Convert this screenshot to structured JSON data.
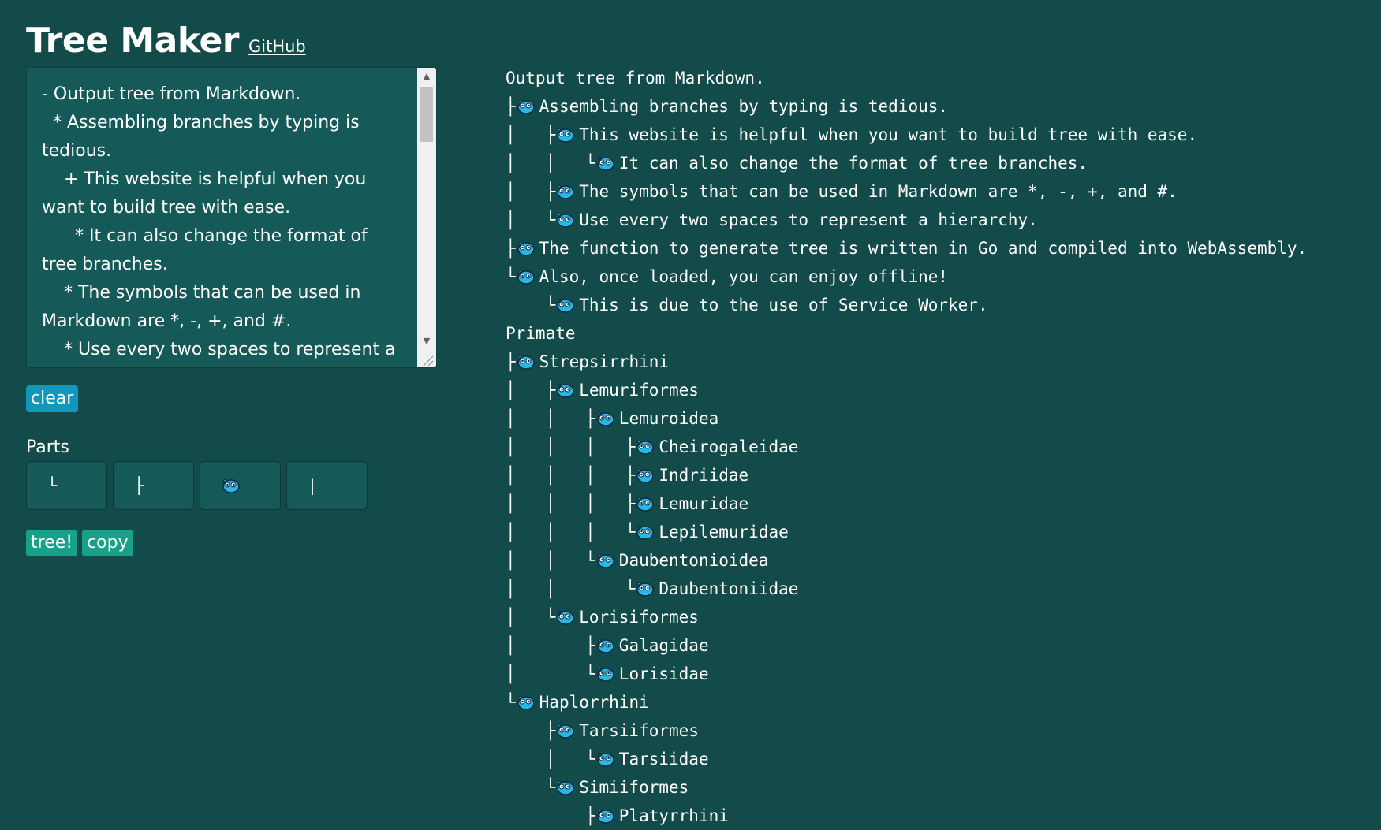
{
  "header": {
    "title": "Tree Maker",
    "github_label": "GitHub"
  },
  "editor": {
    "value": "- Output tree from Markdown.\n  * Assembling branches by typing is tedious.\n    + This website is helpful when you want to build tree with ease.\n      * It can also change the format of tree branches.\n    * The symbols that can be used in Markdown are *, -, +, and #.\n    * Use every two spaces to represent a"
  },
  "buttons": {
    "clear": "clear",
    "tree": "tree!",
    "copy": "copy"
  },
  "parts": {
    "label": "Parts",
    "items": [
      {
        "symbol": "└",
        "icon": ""
      },
      {
        "symbol": "├",
        "icon": ""
      },
      {
        "symbol": "",
        "icon": "go-gopher-icon"
      },
      {
        "symbol": "|",
        "icon": ""
      }
    ]
  },
  "colors": {
    "background": "#134a4a",
    "editor_bg": "#155a58",
    "clear_button": "#1197b9",
    "action_button": "#17a08a",
    "icon_blue": "#29b8e6"
  },
  "output": {
    "lines": [
      {
        "prefix": "",
        "icon": false,
        "text": "Output tree from Markdown."
      },
      {
        "prefix": "├",
        "icon": true,
        "text": "Assembling branches by typing is tedious."
      },
      {
        "prefix": "│   ├",
        "icon": true,
        "text": "This website is helpful when you want to build tree with ease."
      },
      {
        "prefix": "│   │   └",
        "icon": true,
        "text": "It can also change the format of tree branches."
      },
      {
        "prefix": "│   ├",
        "icon": true,
        "text": "The symbols that can be used in Markdown are *, -, +, and #."
      },
      {
        "prefix": "│   └",
        "icon": true,
        "text": "Use every two spaces to represent a hierarchy."
      },
      {
        "prefix": "├",
        "icon": true,
        "text": "The function to generate tree is written in Go and compiled into WebAssembly."
      },
      {
        "prefix": "└",
        "icon": true,
        "text": "Also, once loaded, you can enjoy offline!"
      },
      {
        "prefix": "    └",
        "icon": true,
        "text": "This is due to the use of Service Worker."
      },
      {
        "prefix": "",
        "icon": false,
        "text": "Primate"
      },
      {
        "prefix": "├",
        "icon": true,
        "text": "Strepsirrhini"
      },
      {
        "prefix": "│   ├",
        "icon": true,
        "text": "Lemuriformes"
      },
      {
        "prefix": "│   │   ├",
        "icon": true,
        "text": "Lemuroidea"
      },
      {
        "prefix": "│   │   │   ├",
        "icon": true,
        "text": "Cheirogaleidae"
      },
      {
        "prefix": "│   │   │   ├",
        "icon": true,
        "text": "Indriidae"
      },
      {
        "prefix": "│   │   │   ├",
        "icon": true,
        "text": "Lemuridae"
      },
      {
        "prefix": "│   │   │   └",
        "icon": true,
        "text": "Lepilemuridae"
      },
      {
        "prefix": "│   │   └",
        "icon": true,
        "text": "Daubentonioidea"
      },
      {
        "prefix": "│   │       └",
        "icon": true,
        "text": "Daubentoniidae"
      },
      {
        "prefix": "│   └",
        "icon": true,
        "text": "Lorisiformes"
      },
      {
        "prefix": "│       ├",
        "icon": true,
        "text": "Galagidae"
      },
      {
        "prefix": "│       └",
        "icon": true,
        "text": "Lorisidae"
      },
      {
        "prefix": "└",
        "icon": true,
        "text": "Haplorrhini"
      },
      {
        "prefix": "    ├",
        "icon": true,
        "text": "Tarsiiformes"
      },
      {
        "prefix": "    │   └",
        "icon": true,
        "text": "Tarsiidae"
      },
      {
        "prefix": "    └",
        "icon": true,
        "text": "Simiiformes"
      },
      {
        "prefix": "        ├",
        "icon": true,
        "text": "Platyrrhini"
      }
    ]
  }
}
